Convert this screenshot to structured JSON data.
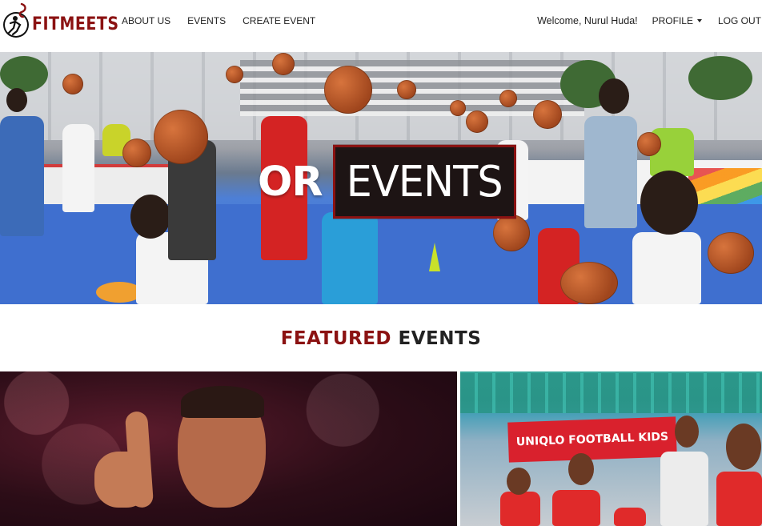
{
  "brand": {
    "name": "FITMEETS"
  },
  "nav": {
    "about": "ABOUT US",
    "events": "EVENTS",
    "create": "CREATE EVENT",
    "welcome": "Welcome, Nurul Huda!",
    "profile": "PROFILE",
    "logout": "LOG OUT"
  },
  "hero": {
    "prefix": "OR",
    "highlight": "EVENTS"
  },
  "featured": {
    "title_part1": "FEATURED",
    "title_part2": "EVENTS"
  },
  "cards": [
    {
      "name": "basketball-player-event"
    },
    {
      "name": "football-kids-event",
      "banner_text": "UNIQLO FOOTBALL KIDS"
    }
  ],
  "colors": {
    "brand": "#8b1212",
    "text": "#222222",
    "hero_box": "#1d1414"
  }
}
